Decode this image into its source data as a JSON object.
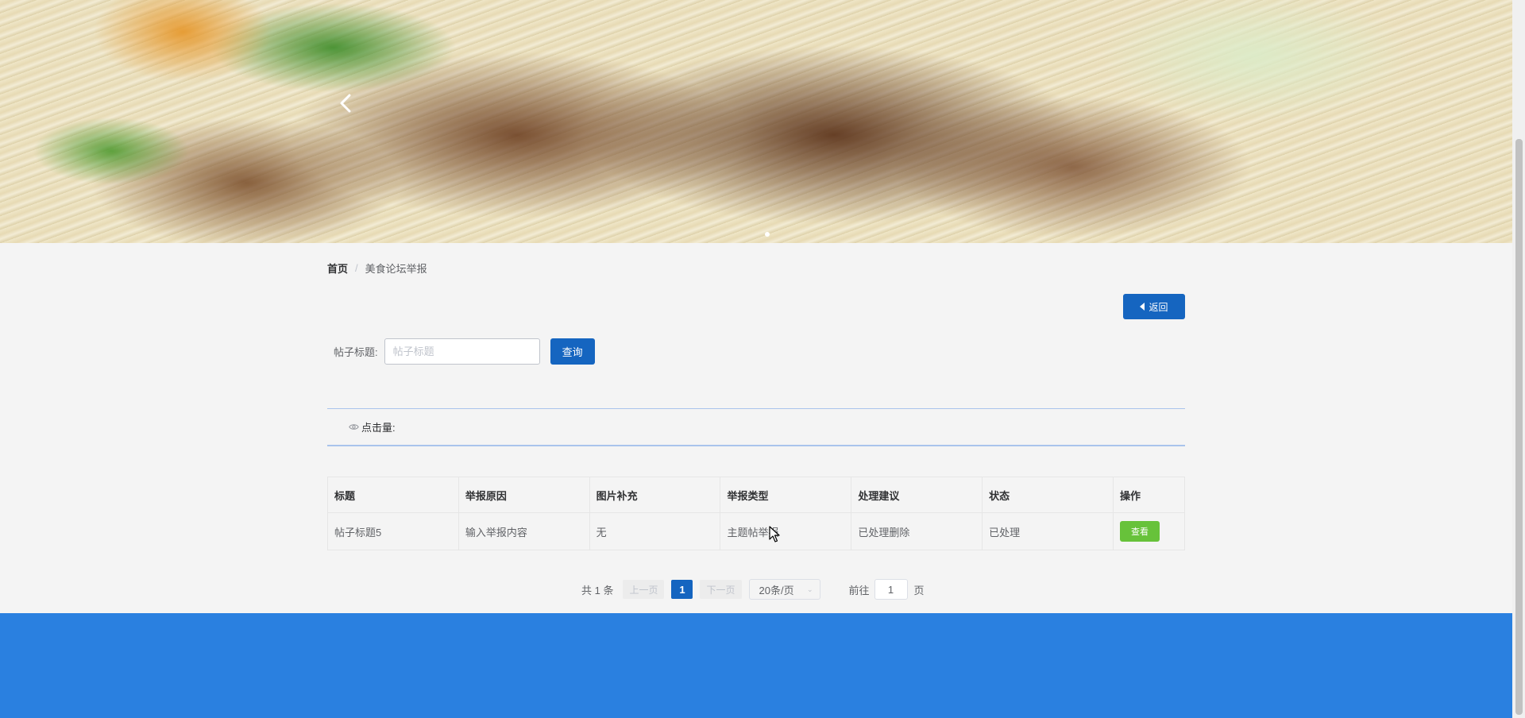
{
  "breadcrumb": {
    "home": "首页",
    "separator": "/",
    "current": "美食论坛举报"
  },
  "toolbar": {
    "back_label": "返回"
  },
  "search": {
    "label": "帖子标题:",
    "placeholder": "帖子标题",
    "button_label": "查询"
  },
  "stats": {
    "clicks_label": "点击量:"
  },
  "table": {
    "headers": [
      "标题",
      "举报原因",
      "图片补充",
      "举报类型",
      "处理建议",
      "状态",
      "操作"
    ],
    "rows": [
      {
        "title": "帖子标题5",
        "reason": "输入举报内容",
        "image": "无",
        "type": "主题帖举报",
        "suggestion": "已处理删除",
        "status": "已处理",
        "action_label": "查看"
      }
    ]
  },
  "pagination": {
    "total": "共 1 条",
    "prev": "上一页",
    "current_page": "1",
    "next": "下一页",
    "page_size": "20条/页",
    "goto_prefix": "前往",
    "goto_value": "1",
    "goto_suffix": "页"
  },
  "colors": {
    "primary": "#1565c0",
    "success": "#67c23a",
    "footer": "#2a80e0"
  },
  "icons": {
    "banner_prev": "chevron-left-icon",
    "back": "caret-left-icon",
    "clicks": "eye-icon"
  }
}
